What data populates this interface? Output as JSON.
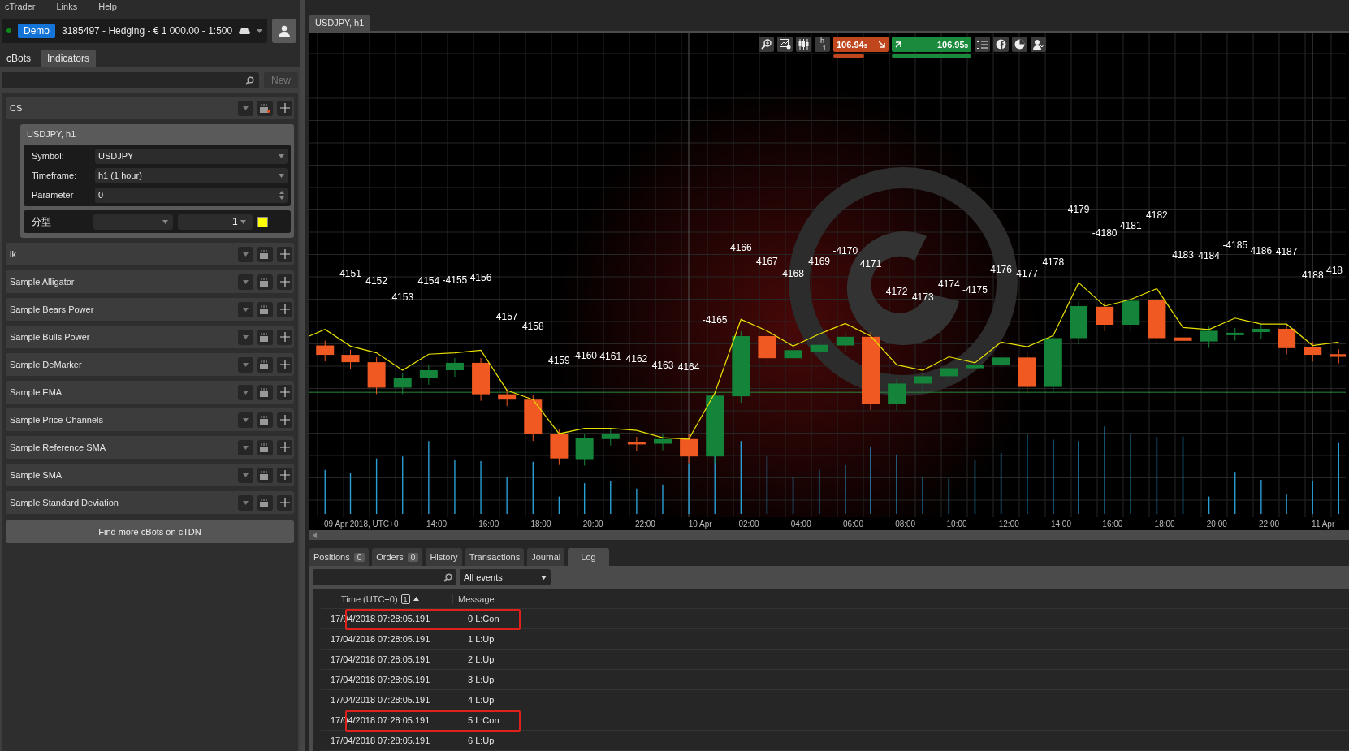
{
  "menu": [
    "cTrader",
    "Links",
    "Help"
  ],
  "account": {
    "connected": true,
    "mode": "Demo",
    "label": "3185497 - Hedging - € 1 000.00 - 1:500"
  },
  "side_tabs": [
    {
      "label": "cBots",
      "selected": false
    },
    {
      "label": "Indicators",
      "selected": true
    }
  ],
  "search": {
    "button": "New"
  },
  "indicators": [
    {
      "name": "CS",
      "expanded": true,
      "instance": {
        "title": "USDJPY, h1",
        "params": [
          {
            "label": "Symbol:",
            "value": "USDJPY",
            "kind": "select"
          },
          {
            "label": "Timeframe:",
            "value": "h1 (1 hour)",
            "kind": "select"
          },
          {
            "label": "Parameter",
            "value": "0",
            "kind": "number"
          }
        ],
        "output": {
          "label": "分型",
          "thickness": "1",
          "color": "#ffff00"
        }
      }
    },
    {
      "name": "lk",
      "expanded": false
    },
    {
      "name": "Sample Alligator",
      "expanded": false
    },
    {
      "name": "Sample Bears Power",
      "expanded": false
    },
    {
      "name": "Sample Bulls Power",
      "expanded": false
    },
    {
      "name": "Sample DeMarker",
      "expanded": false
    },
    {
      "name": "Sample EMA",
      "expanded": false
    },
    {
      "name": "Sample Price Channels",
      "expanded": false
    },
    {
      "name": "Sample Reference SMA",
      "expanded": false
    },
    {
      "name": "Sample SMA",
      "expanded": false
    },
    {
      "name": "Sample Standard Deviation",
      "expanded": false
    }
  ],
  "find_more": "Find more cBots on cTDN",
  "chart": {
    "tab": "USDJPY, h1",
    "toolbar": {
      "timeframe": "h",
      "timeframe_sub": "1",
      "sell": {
        "price": "106.94",
        "pip": "9"
      },
      "buy": {
        "price": "106.95",
        "pip": "5"
      }
    },
    "bar_labels": [
      "4151",
      "4152",
      "4153",
      "4154",
      "-4155",
      "4156",
      "4157",
      "4158",
      "4159",
      "-4160",
      "4161",
      "4162",
      "4163",
      "4164",
      "-4165",
      "4166",
      "4167",
      "4168",
      "4169",
      "-4170",
      "4171",
      "4172",
      "4173",
      "4174",
      "-4175",
      "4176",
      "4177",
      "4178",
      "4179",
      "-4180",
      "4181",
      "4182",
      "4183",
      "4184",
      "-4185",
      "4186",
      "4187",
      "4188",
      "418"
    ],
    "time_axis": [
      "09 Apr 2018, UTC+0",
      "14:00",
      "16:00",
      "18:00",
      "20:00",
      "22:00",
      "10 Apr",
      "02:00",
      "04:00",
      "06:00",
      "08:00",
      "10:00",
      "12:00",
      "14:00",
      "16:00",
      "18:00",
      "20:00",
      "22:00",
      "11 Apr"
    ]
  },
  "bottom_tabs": [
    {
      "label": "Positions",
      "count": "0",
      "selected": false
    },
    {
      "label": "Orders",
      "count": "0",
      "selected": false
    },
    {
      "label": "History",
      "selected": false
    },
    {
      "label": "Transactions",
      "selected": false
    },
    {
      "label": "Journal",
      "selected": false
    },
    {
      "label": "Log",
      "selected": true
    }
  ],
  "log": {
    "filter": "All events",
    "columns": [
      "Time (UTC+0)",
      "Message"
    ],
    "sort_badge": "1",
    "rows": [
      {
        "time": "17/04/2018 07:28:05.191",
        "message": "0 L:Con",
        "marked": true
      },
      {
        "time": "17/04/2018 07:28:05.191",
        "message": "1 L:Up",
        "marked": false
      },
      {
        "time": "17/04/2018 07:28:05.191",
        "message": "2 L:Up",
        "marked": false
      },
      {
        "time": "17/04/2018 07:28:05.191",
        "message": "3 L:Up",
        "marked": false
      },
      {
        "time": "17/04/2018 07:28:05.191",
        "message": "4 L:Up",
        "marked": false
      },
      {
        "time": "17/04/2018 07:28:05.191",
        "message": "5 L:Con",
        "marked": true
      },
      {
        "time": "17/04/2018 07:28:05.191",
        "message": "6 L:Up",
        "marked": false
      }
    ]
  }
}
